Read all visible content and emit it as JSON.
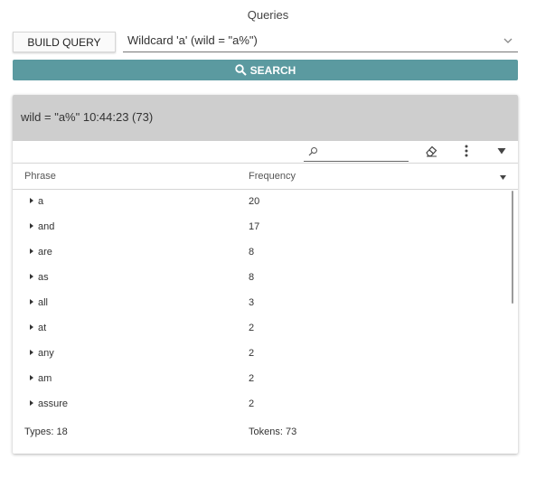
{
  "page": {
    "title": "Queries"
  },
  "controls": {
    "build_query_label": "BUILD QUERY",
    "query_selected": "Wildcard 'a' (wild = \"a%\")",
    "search_label": "SEARCH"
  },
  "result": {
    "header": "wild = \"a%\" 10:44:23 (73)",
    "columns": {
      "phrase": "Phrase",
      "frequency": "Frequency"
    },
    "rows": [
      {
        "phrase": "a",
        "frequency": "20"
      },
      {
        "phrase": "and",
        "frequency": "17"
      },
      {
        "phrase": "are",
        "frequency": "8"
      },
      {
        "phrase": "as",
        "frequency": "8"
      },
      {
        "phrase": "all",
        "frequency": "3"
      },
      {
        "phrase": "at",
        "frequency": "2"
      },
      {
        "phrase": "any",
        "frequency": "2"
      },
      {
        "phrase": "am",
        "frequency": "2"
      },
      {
        "phrase": "assure",
        "frequency": "2"
      }
    ],
    "footer": {
      "types": "Types: 18",
      "tokens": "Tokens: 73"
    }
  },
  "icons": {
    "dropdown": "chevron-down-icon",
    "search": "search-icon",
    "filter": "magnifier-icon",
    "clear": "eraser-icon",
    "menu": "more-vertical-icon",
    "collapse": "triangle-down-icon",
    "row_expand": "triangle-right-icon"
  },
  "colors": {
    "accent": "#5b9aa0",
    "header_bg": "#cecece"
  }
}
